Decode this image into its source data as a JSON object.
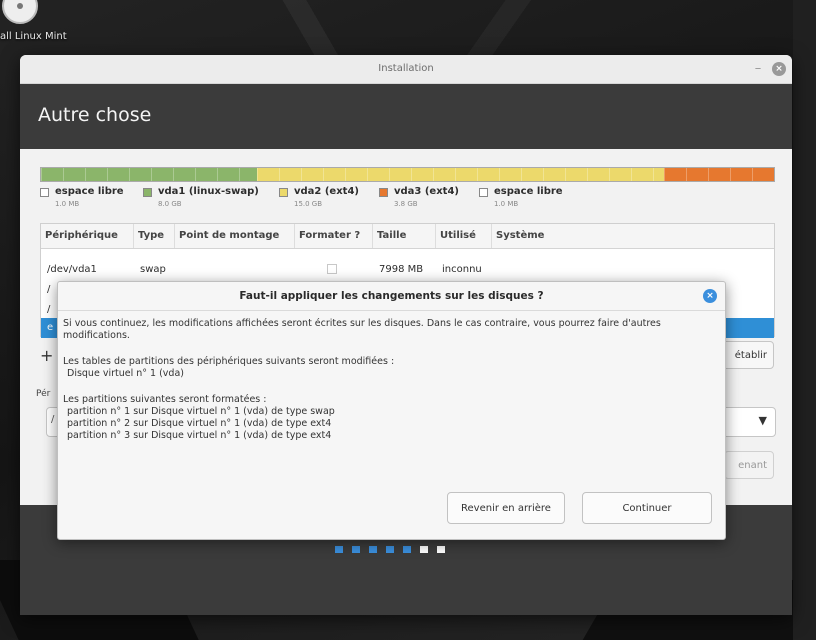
{
  "desktop": {
    "icon_label": "all Linux Mint"
  },
  "window": {
    "title": "Installation",
    "minimize_label": "–",
    "close_label": "×"
  },
  "page": {
    "title": "Autre chose"
  },
  "partition_bar": {
    "segments": [
      {
        "name": "vda1 (linux-swap)",
        "color": "#8bb56a",
        "fraction": 0.295
      },
      {
        "name": "vda2 (ext4)",
        "color": "#ecd96b",
        "fraction": 0.555
      },
      {
        "name": "vda3 (ext4)",
        "color": "#e6782f",
        "fraction": 0.15
      }
    ]
  },
  "legend": [
    {
      "name": "espace libre",
      "size": "1.0 MB",
      "color": "#ffffff"
    },
    {
      "name": "vda1 (linux-swap)",
      "size": "8.0 GB",
      "color": "#8bb56a"
    },
    {
      "name": "vda2 (ext4)",
      "size": "15.0 GB",
      "color": "#ecd96b"
    },
    {
      "name": "vda3 (ext4)",
      "size": "3.8 GB",
      "color": "#e6782f"
    },
    {
      "name": "espace libre",
      "size": "1.0 MB",
      "color": "#ffffff"
    }
  ],
  "table": {
    "headers": [
      "Périphérique",
      "Type",
      "Point de montage",
      "Formater ?",
      "Taille",
      "Utilisé",
      "Système"
    ],
    "rows": [
      {
        "device": "/dev/vda1",
        "type": "swap",
        "mount": "",
        "size": "7998 MB",
        "used": "inconnu",
        "system": ""
      }
    ],
    "partial_rows": [
      "/",
      "/",
      "e"
    ]
  },
  "controls": {
    "add_label": "+",
    "revert_label": "établir",
    "boot_device_label": "Pér",
    "boot_device_value": "/",
    "install_now_label": "enant"
  },
  "dialog": {
    "title": "Faut-il appliquer les changements sur les disques ?",
    "close_label": "×",
    "line1": "Si vous continuez, les modifications affichées seront écrites sur les disques. Dans le cas contraire, vous pourrez faire d'autres modifications.",
    "line2": "Les tables de partitions des périphériques suivants seront modifiées :",
    "line3": "Disque virtuel n° 1 (vda)",
    "line4": "Les partitions suivantes seront formatées :",
    "line5": "partition n° 1 sur Disque virtuel n° 1 (vda) de type swap",
    "line6": "partition n° 2 sur Disque virtuel n° 1 (vda) de type ext4",
    "line7": "partition n° 3 sur Disque virtuel n° 1 (vda) de type ext4",
    "back_label": "Revenir en arrière",
    "continue_label": "Continuer"
  },
  "progress": {
    "total_steps": 7,
    "completed_steps": 5,
    "done_color": "#3b8fdd",
    "todo_color": "#ffffff"
  }
}
